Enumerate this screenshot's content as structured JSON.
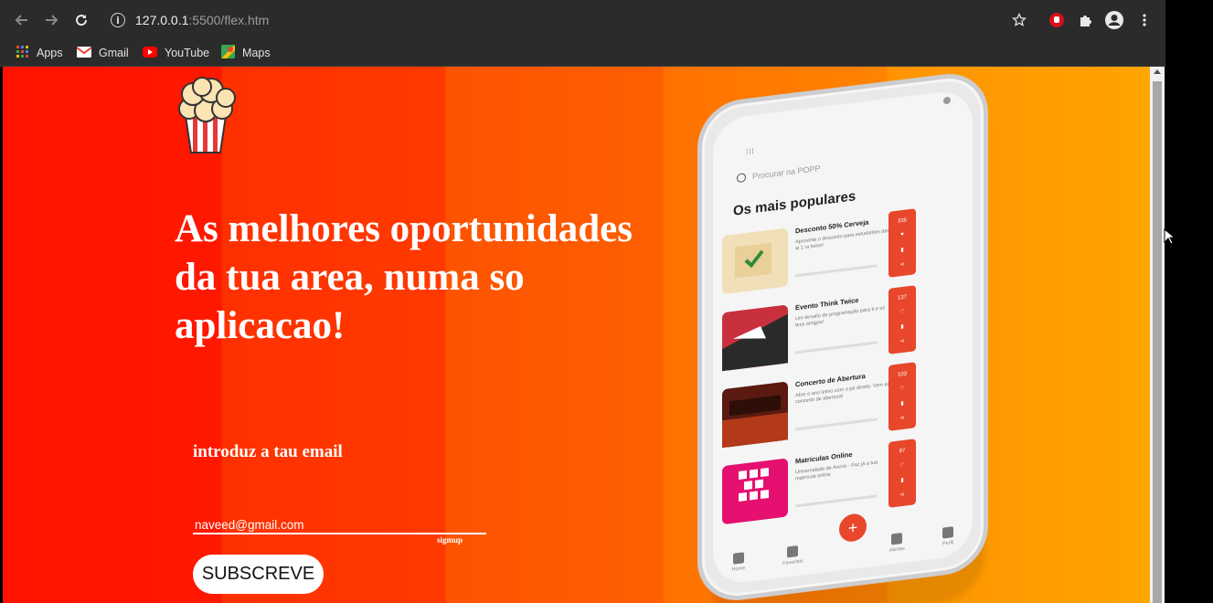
{
  "browser": {
    "url_host": "127.0.0.1",
    "url_path": ":5500/flex.htm",
    "nav_icons": [
      "back-arrow-icon",
      "forward-arrow-icon",
      "reload-icon"
    ],
    "bookmarks": [
      {
        "label": "Apps",
        "icon": "apps-grid-icon"
      },
      {
        "label": "Gmail",
        "icon": "gmail-icon"
      },
      {
        "label": "YouTube",
        "icon": "youtube-icon"
      },
      {
        "label": "Maps",
        "icon": "maps-icon"
      }
    ]
  },
  "hero": {
    "headline": "As melhores oportunidades da tua area, numa so aplicacao!",
    "email_label": "introduz a tau email",
    "email_value": "naveed@gmail.com",
    "signup_label": "sigmup",
    "subscribe_label": "SUBSCREVE"
  },
  "phone": {
    "search_placeholder": "Procurar na POPP",
    "section_title": "Os mais populares",
    "cards": [
      {
        "title": "Desconto 50% Cerveja",
        "count": "335",
        "sub": "Aproveita o desconto para estudantes das 4 ai 1 ra twice!"
      },
      {
        "title": "Evento Think Twice",
        "count": "137",
        "sub": "Um desafio de programação para ti e os teus amigos!"
      },
      {
        "title": "Concerto de Abertura",
        "count": "103",
        "sub": "Abre o ano letivo com o pé direito. Vem ao concerto de abertura!"
      },
      {
        "title": "Matriculas Online",
        "count": "87",
        "sub": "Universidade de Aveiro - Faz já a tua matrícula online"
      }
    ],
    "nav": [
      "Home",
      "Favoritos",
      "Alertas",
      "Perfil"
    ]
  },
  "colors": {
    "accent": "#e8472b",
    "chrome": "#2b2b2b"
  }
}
